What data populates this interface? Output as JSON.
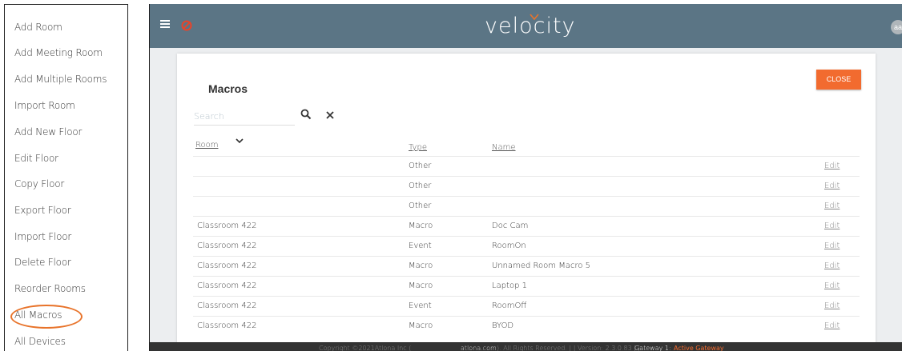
{
  "sidebar": {
    "items": [
      {
        "label": "Add Room"
      },
      {
        "label": "Add Meeting Room"
      },
      {
        "label": "Add Multiple Rooms"
      },
      {
        "label": "Import Room"
      },
      {
        "label": "Add New Floor"
      },
      {
        "label": "Edit Floor"
      },
      {
        "label": "Copy Floor"
      },
      {
        "label": "Export Floor"
      },
      {
        "label": "Import Floor"
      },
      {
        "label": "Delete Floor"
      },
      {
        "label": "Reorder Rooms"
      },
      {
        "label": "All Macros"
      },
      {
        "label": "All Devices"
      }
    ],
    "highlight_color": "#e8732a"
  },
  "header": {
    "brand": "velocity",
    "avatar_initials": "aa",
    "bar_color": "#5b7585",
    "accent_color": "#e8442a",
    "icons": [
      "hamburger-menu-icon",
      "atlona-logo-icon"
    ]
  },
  "main": {
    "title": "Macros",
    "close_label": "CLOSE",
    "close_color": "#f26b2f",
    "search": {
      "placeholder": "Search",
      "value": ""
    },
    "columns": {
      "room": "Room",
      "type": "Type",
      "name": "Name"
    },
    "sort_icon": "chevron-down-icon",
    "rows": [
      {
        "room": "",
        "type": "Other",
        "name": "",
        "action": "Edit"
      },
      {
        "room": "",
        "type": "Other",
        "name": "",
        "action": "Edit"
      },
      {
        "room": "",
        "type": "Other",
        "name": "",
        "action": "Edit"
      },
      {
        "room": "Classroom 422",
        "type": "Macro",
        "name": "Doc Cam",
        "action": "Edit"
      },
      {
        "room": "Classroom 422",
        "type": "Event",
        "name": "RoomOn",
        "action": "Edit"
      },
      {
        "room": "Classroom 422",
        "type": "Macro",
        "name": "Unnamed Room Macro 5",
        "action": "Edit"
      },
      {
        "room": "Classroom 422",
        "type": "Macro",
        "name": "Laptop 1",
        "action": "Edit"
      },
      {
        "room": "Classroom 422",
        "type": "Event",
        "name": "RoomOff",
        "action": "Edit"
      },
      {
        "room": "Classroom 422",
        "type": "Macro",
        "name": "BYOD",
        "action": "Edit"
      }
    ]
  },
  "footer": {
    "copyright": "Copyright ©2021Atlona Inc (",
    "link": "atlona.com",
    "rest": "). All Rights Reserved. | | Version: 2.3.0.83 | |",
    "gateway_label": "Gateway 1:",
    "gateway_status": "Active Gateway"
  }
}
